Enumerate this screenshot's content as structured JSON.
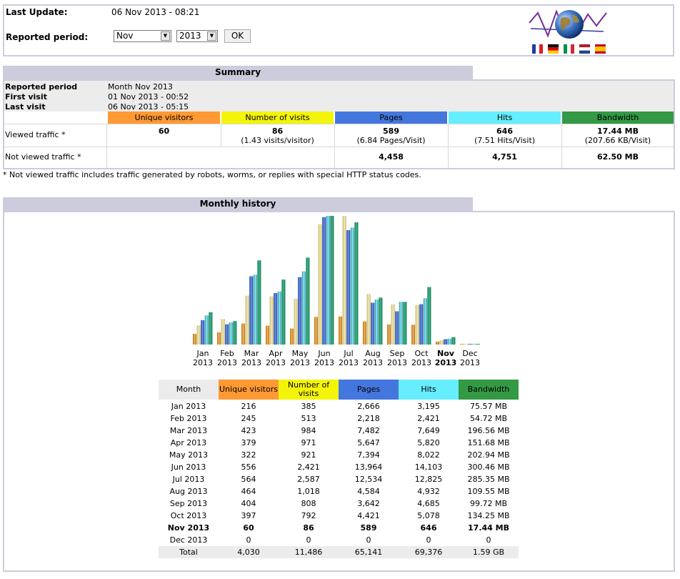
{
  "header": {
    "last_update_label": "Last Update:",
    "last_update_value": "06 Nov 2013 - 08:21",
    "reported_period_label": "Reported period:",
    "month_select": "Nov",
    "year_select": "2013",
    "ok_button": "OK"
  },
  "colors": {
    "unique": "#ff9933",
    "visits": "#f4f40a",
    "pages": "#4477dd",
    "hits": "#66eeff",
    "bandwidth": "#339944",
    "section": "#ccccdd"
  },
  "summary": {
    "title": "Summary",
    "reported_period_label": "Reported period",
    "reported_period_value": "Month Nov 2013",
    "first_visit_label": "First visit",
    "first_visit_value": "01 Nov 2013 - 00:52",
    "last_visit_label": "Last visit",
    "last_visit_value": "06 Nov 2013 - 05:15",
    "col_unique": "Unique visitors",
    "col_visits": "Number of visits",
    "col_pages": "Pages",
    "col_hits": "Hits",
    "col_bandwidth": "Bandwidth",
    "viewed_label": "Viewed traffic *",
    "viewed_unique": "60",
    "viewed_visits": "86",
    "viewed_visits_sub": "(1.43 visits/visitor)",
    "viewed_pages": "589",
    "viewed_pages_sub": "(6.84 Pages/Visit)",
    "viewed_hits": "646",
    "viewed_hits_sub": "(7.51 Hits/Visit)",
    "viewed_bandwidth": "17.44 MB",
    "viewed_bandwidth_sub": "(207.66 KB/Visit)",
    "notviewed_label": "Not viewed traffic *",
    "notviewed_pages": "4,458",
    "notviewed_hits": "4,751",
    "notviewed_bandwidth": "62.50 MB",
    "footnote": "* Not viewed traffic includes traffic generated by robots, worms, or replies with special HTTP status codes."
  },
  "monthly": {
    "title": "Monthly history",
    "headers": {
      "month": "Month",
      "unique": "Unique visitors",
      "visits": "Number of visits",
      "pages": "Pages",
      "hits": "Hits",
      "bandwidth": "Bandwidth"
    },
    "rows": [
      {
        "month": "Jan 2013",
        "unique": "216",
        "visits": "385",
        "pages": "2,666",
        "hits": "3,195",
        "bandwidth": "75.57 MB"
      },
      {
        "month": "Feb 2013",
        "unique": "245",
        "visits": "513",
        "pages": "2,218",
        "hits": "2,421",
        "bandwidth": "54.72 MB"
      },
      {
        "month": "Mar 2013",
        "unique": "423",
        "visits": "984",
        "pages": "7,482",
        "hits": "7,649",
        "bandwidth": "196.56 MB"
      },
      {
        "month": "Apr 2013",
        "unique": "379",
        "visits": "971",
        "pages": "5,647",
        "hits": "5,820",
        "bandwidth": "151.68 MB"
      },
      {
        "month": "May 2013",
        "unique": "322",
        "visits": "921",
        "pages": "7,394",
        "hits": "8,022",
        "bandwidth": "202.94 MB"
      },
      {
        "month": "Jun 2013",
        "unique": "556",
        "visits": "2,421",
        "pages": "13,964",
        "hits": "14,103",
        "bandwidth": "300.46 MB"
      },
      {
        "month": "Jul 2013",
        "unique": "564",
        "visits": "2,587",
        "pages": "12,534",
        "hits": "12,825",
        "bandwidth": "285.35 MB"
      },
      {
        "month": "Aug 2013",
        "unique": "464",
        "visits": "1,018",
        "pages": "4,584",
        "hits": "4,932",
        "bandwidth": "109.55 MB"
      },
      {
        "month": "Sep 2013",
        "unique": "404",
        "visits": "808",
        "pages": "3,642",
        "hits": "4,685",
        "bandwidth": "99.72 MB"
      },
      {
        "month": "Oct 2013",
        "unique": "397",
        "visits": "792",
        "pages": "4,421",
        "hits": "5,078",
        "bandwidth": "134.25 MB"
      },
      {
        "month": "Nov 2013",
        "unique": "60",
        "visits": "86",
        "pages": "589",
        "hits": "646",
        "bandwidth": "17.44 MB"
      },
      {
        "month": "Dec 2013",
        "unique": "0",
        "visits": "0",
        "pages": "0",
        "hits": "0",
        "bandwidth": "0"
      }
    ],
    "total": {
      "month": "Total",
      "unique": "4,030",
      "visits": "11,486",
      "pages": "65,141",
      "hits": "69,376",
      "bandwidth": "1.59 GB"
    }
  },
  "chart_data": {
    "type": "bar",
    "categories": [
      "Jan 2013",
      "Feb 2013",
      "Mar 2013",
      "Apr 2013",
      "May 2013",
      "Jun 2013",
      "Jul 2013",
      "Aug 2013",
      "Sep 2013",
      "Oct 2013",
      "Nov 2013",
      "Dec 2013"
    ],
    "category_labels": [
      [
        "Jan",
        "2013"
      ],
      [
        "Feb",
        "2013"
      ],
      [
        "Mar",
        "2013"
      ],
      [
        "Apr",
        "2013"
      ],
      [
        "May",
        "2013"
      ],
      [
        "Jun",
        "2013"
      ],
      [
        "Jul",
        "2013"
      ],
      [
        "Aug",
        "2013"
      ],
      [
        "Sep",
        "2013"
      ],
      [
        "Oct",
        "2013"
      ],
      [
        "Nov",
        "2013"
      ],
      [
        "Dec",
        "2013"
      ]
    ],
    "highlight_index": 10,
    "series": [
      {
        "key": "unique",
        "values": [
          216,
          245,
          423,
          379,
          322,
          556,
          564,
          464,
          404,
          397,
          60,
          0
        ],
        "color": "#e0902a"
      },
      {
        "key": "visits",
        "values": [
          385,
          513,
          984,
          971,
          921,
          2421,
          2587,
          1018,
          808,
          792,
          86,
          0
        ],
        "color": "#e8d890"
      },
      {
        "key": "pages",
        "values": [
          2666,
          2218,
          7482,
          5647,
          7394,
          13964,
          12534,
          4584,
          3642,
          4421,
          589,
          0
        ],
        "color": "#3a66cc"
      },
      {
        "key": "hits",
        "values": [
          3195,
          2421,
          7649,
          5820,
          8022,
          14103,
          12825,
          4932,
          4685,
          5078,
          646,
          0
        ],
        "color": "#50c8d8"
      },
      {
        "key": "bandwidth",
        "values": [
          75.57,
          54.72,
          196.56,
          151.68,
          202.94,
          300.46,
          285.35,
          109.55,
          99.72,
          134.25,
          17.44,
          0
        ],
        "color": "#22906a"
      }
    ],
    "scale_groups": [
      [
        "unique",
        "visits"
      ],
      [
        "pages",
        "hits"
      ],
      [
        "bandwidth"
      ]
    ]
  }
}
